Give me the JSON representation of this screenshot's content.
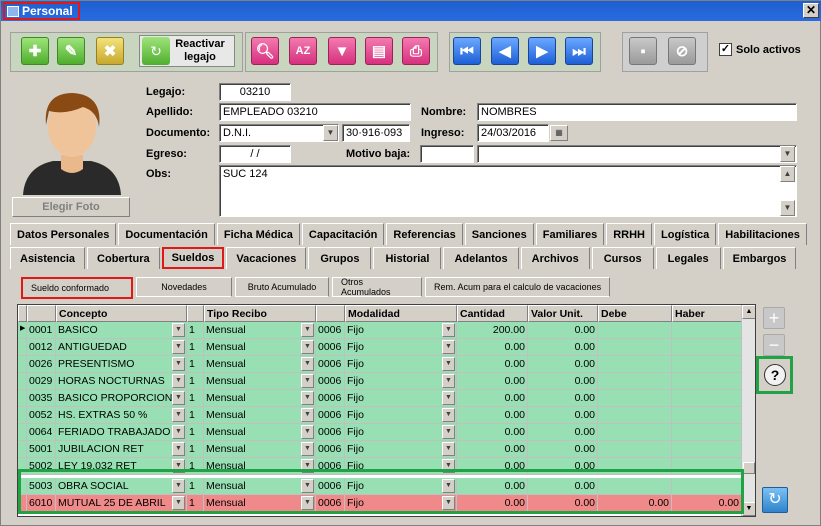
{
  "window": {
    "title": "Personal"
  },
  "toolbar": {
    "reactivar_label_1": "Reactivar",
    "reactivar_label_2": "legajo",
    "solo_activos_label": "Solo activos",
    "solo_activos_checked": "✓"
  },
  "photo": {
    "button_label": "Elegir Foto"
  },
  "form": {
    "legajo_label": "Legajo:",
    "legajo_value": "03210",
    "apellido_label": "Apellido:",
    "apellido_value": "EMPLEADO 03210",
    "nombre_label": "Nombre:",
    "nombre_value": "NOMBRES",
    "documento_label": "Documento:",
    "documento_tipo": "D.N.I.",
    "documento_numero": "30·916·093",
    "ingreso_label": "Ingreso:",
    "ingreso_value": "24/03/2016",
    "egreso_label": "Egreso:",
    "egreso_value": "  /  /",
    "motivo_label": "Motivo baja:",
    "motivo_value": "",
    "obs_label": "Obs:",
    "obs_value": "SUC 124"
  },
  "tabs_row1": [
    "Datos Personales",
    "Documentación",
    "Ficha Médica",
    "Capacitación",
    "Referencias",
    "Sanciones",
    "Familiares",
    "RRHH",
    "Logística",
    "Habilitaciones"
  ],
  "tabs_row2": [
    "Asistencia",
    "Cobertura",
    "Sueldos",
    "Vacaciones",
    "Grupos",
    "Historial",
    "Adelantos",
    "Archivos",
    "Cursos",
    "Legales",
    "Embargos"
  ],
  "subtabs": [
    "Sueldo conformado",
    "Novedades",
    "Bruto Acumulado",
    "Otros Acumulados",
    "Rem. Acum para el calculo de vacaciones"
  ],
  "grid": {
    "headers": [
      "Concepto",
      "Tipo Recibo",
      "Modalidad",
      "Cantidad",
      "Valor Unit.",
      "Debe",
      "Haber"
    ],
    "rows": [
      {
        "code": "0001",
        "concepto": "BASICO",
        "n": "1",
        "tipo": "Mensual",
        "mod_code": "0006",
        "modalidad": "Fijo",
        "cantidad": "200.00",
        "valor": "0.00",
        "debe": "",
        "haber": ""
      },
      {
        "code": "0012",
        "concepto": "ANTIGUEDAD",
        "n": "1",
        "tipo": "Mensual",
        "mod_code": "0006",
        "modalidad": "Fijo",
        "cantidad": "0.00",
        "valor": "0.00",
        "debe": "",
        "haber": ""
      },
      {
        "code": "0026",
        "concepto": "PRESENTISMO",
        "n": "1",
        "tipo": "Mensual",
        "mod_code": "0006",
        "modalidad": "Fijo",
        "cantidad": "0.00",
        "valor": "0.00",
        "debe": "",
        "haber": ""
      },
      {
        "code": "0029",
        "concepto": "HORAS NOCTURNAS",
        "n": "1",
        "tipo": "Mensual",
        "mod_code": "0006",
        "modalidad": "Fijo",
        "cantidad": "0.00",
        "valor": "0.00",
        "debe": "",
        "haber": ""
      },
      {
        "code": "0035",
        "concepto": "BASICO PROPORCIONA",
        "n": "1",
        "tipo": "Mensual",
        "mod_code": "0006",
        "modalidad": "Fijo",
        "cantidad": "0.00",
        "valor": "0.00",
        "debe": "",
        "haber": ""
      },
      {
        "code": "0052",
        "concepto": "HS. EXTRAS 50 %",
        "n": "1",
        "tipo": "Mensual",
        "mod_code": "0006",
        "modalidad": "Fijo",
        "cantidad": "0.00",
        "valor": "0.00",
        "debe": "",
        "haber": ""
      },
      {
        "code": "0064",
        "concepto": "FERIADO TRABAJADO",
        "n": "1",
        "tipo": "Mensual",
        "mod_code": "0006",
        "modalidad": "Fijo",
        "cantidad": "0.00",
        "valor": "0.00",
        "debe": "",
        "haber": ""
      },
      {
        "code": "5001",
        "concepto": "JUBILACION RET",
        "n": "1",
        "tipo": "Mensual",
        "mod_code": "0006",
        "modalidad": "Fijo",
        "cantidad": "0.00",
        "valor": "0.00",
        "debe": "",
        "haber": ""
      },
      {
        "code": "5002",
        "concepto": "LEY 19.032 RET",
        "n": "1",
        "tipo": "Mensual",
        "mod_code": "0006",
        "modalidad": "Fijo",
        "cantidad": "0.00",
        "valor": "0.00",
        "debe": "",
        "haber": ""
      },
      {
        "code": "5003",
        "concepto": "OBRA SOCIAL",
        "n": "1",
        "tipo": "Mensual",
        "mod_code": "0006",
        "modalidad": "Fijo",
        "cantidad": "0.00",
        "valor": "0.00",
        "debe": "",
        "haber": ""
      },
      {
        "code": "6010",
        "concepto": "MUTUAL 25 DE ABRIL",
        "n": "1",
        "tipo": "Mensual",
        "mod_code": "0006",
        "modalidad": "Fijo",
        "cantidad": "0.00",
        "valor": "0.00",
        "debe": "0.00",
        "haber": "0.00"
      }
    ]
  },
  "side": {
    "help_symbol": "?"
  },
  "colors": {
    "row_green": "#99dfb4",
    "row_red": "#f08a8a",
    "highlight_green": "#21a345",
    "highlight_red": "#e01818"
  }
}
